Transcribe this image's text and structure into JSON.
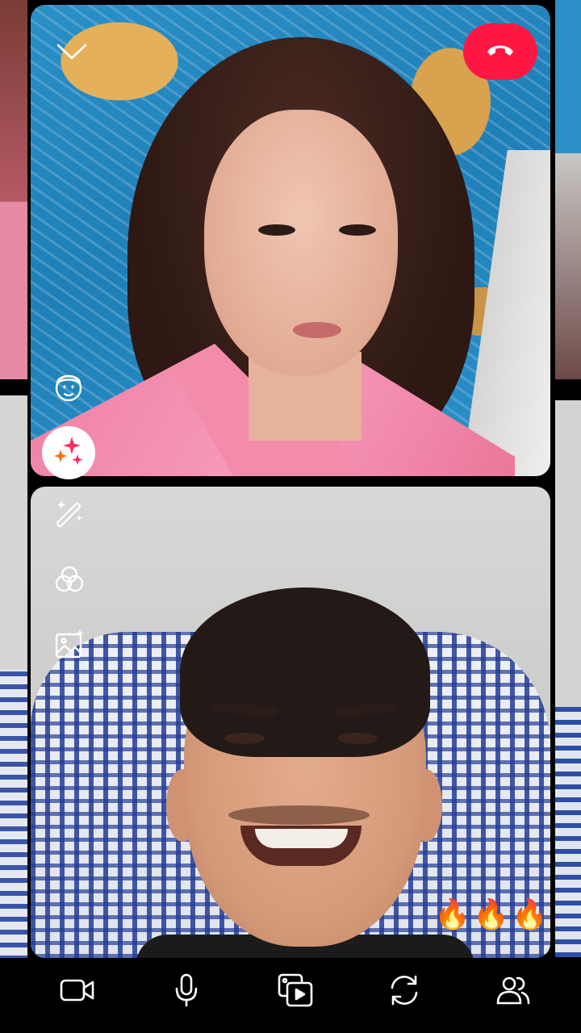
{
  "call": {
    "reactions": [
      "🔥",
      "🔥",
      "🔥"
    ]
  },
  "colors": {
    "hangup": "#ff1744",
    "icon": "#ffffff",
    "background": "#000000"
  },
  "icons": {
    "collapse": "chevron-down-icon",
    "end_call": "phone-hangup-icon",
    "avatar_effect": "heart-eyes-face-icon",
    "effects": "sparkles-icon",
    "touch_up": "magic-wand-icon",
    "filters": "overlapping-circles-icon",
    "background": "image-sparkle-icon",
    "camera": "video-camera-icon",
    "microphone": "microphone-icon",
    "media": "media-share-icon",
    "flip_camera": "flip-camera-icon",
    "participants": "people-icon"
  }
}
